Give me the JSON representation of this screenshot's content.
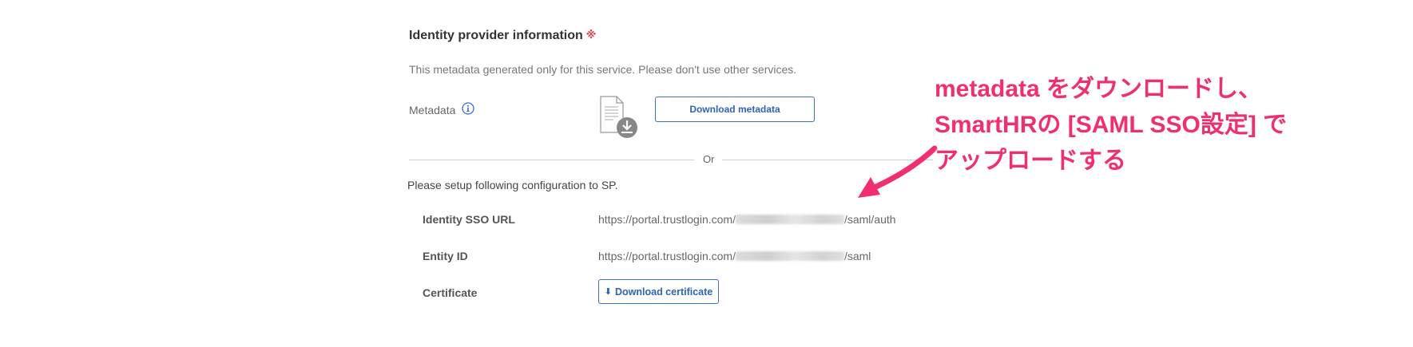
{
  "section": {
    "title": "Identity provider information",
    "required_mark": "※",
    "note": "This metadata generated only for this service. Please don't use other services."
  },
  "metadata": {
    "label": "Metadata",
    "info_icon": "info-circle-icon",
    "doc_icon": "document-download-icon",
    "download_button": "Download metadata"
  },
  "divider": {
    "or": "Or"
  },
  "setup": {
    "intro": "Please setup following configuration to SP.",
    "rows": [
      {
        "key": "Identity SSO URL",
        "prefix": "https://portal.trustlogin.com/",
        "suffix": "/saml/auth"
      },
      {
        "key": "Entity ID",
        "prefix": "https://portal.trustlogin.com/",
        "suffix": "/saml"
      },
      {
        "key": "Certificate",
        "button": "Download certificate",
        "button_icon": "download-icon"
      }
    ]
  },
  "annotation": {
    "lines": [
      "metadata をダウンロードし、",
      "SmartHRの [SAML SSO設定] で",
      "アップロードする"
    ],
    "color": "#f0306e"
  },
  "colors": {
    "link": "#2f63b5",
    "required": "#e0454d",
    "annotation": "#f0306e"
  }
}
